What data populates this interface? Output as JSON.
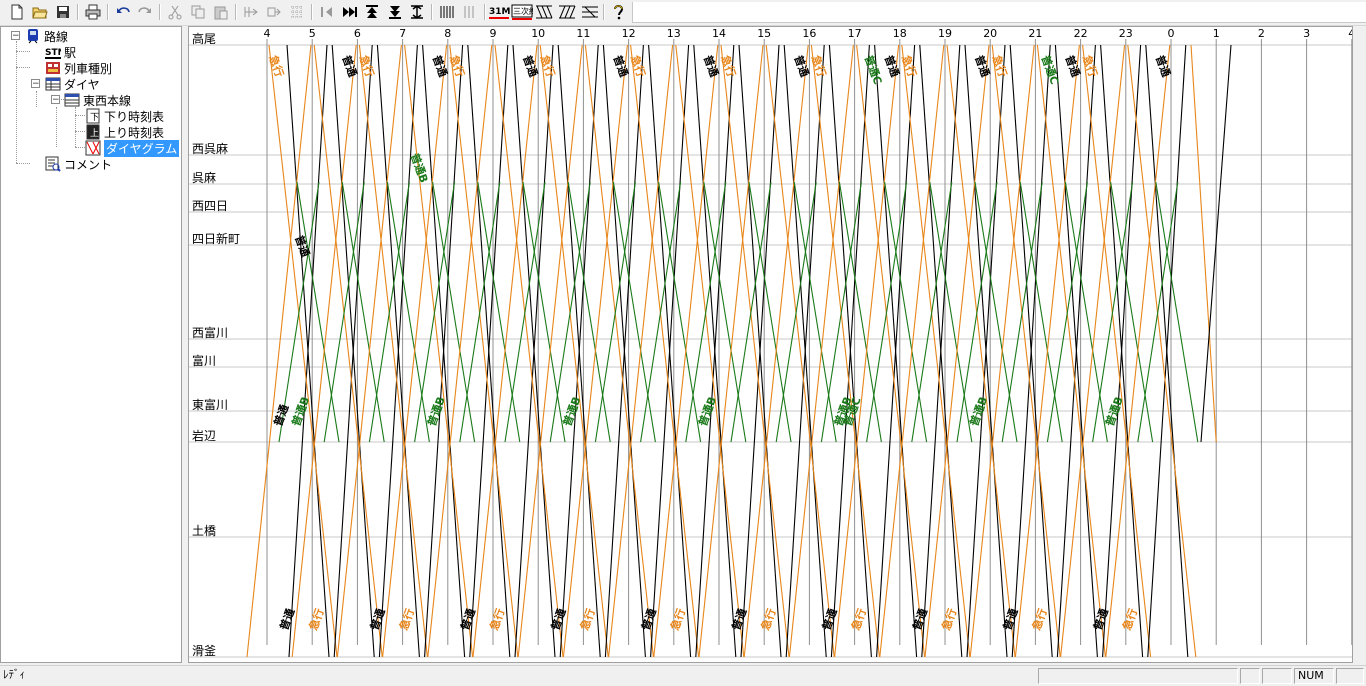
{
  "toolbar": {
    "buttons": [
      {
        "name": "new-file",
        "icon": "new-file-icon"
      },
      {
        "name": "open-folder",
        "icon": "open-folder-icon"
      },
      {
        "name": "save",
        "icon": "save-icon"
      },
      {
        "name": "print",
        "icon": "print-icon"
      },
      {
        "name": "undo",
        "icon": "undo-icon"
      },
      {
        "name": "redo",
        "icon": "redo-icon"
      },
      {
        "name": "cut",
        "icon": "cut-icon"
      },
      {
        "name": "copy",
        "icon": "copy-icon"
      },
      {
        "name": "paste",
        "icon": "paste-icon"
      }
    ],
    "scale_label": "31M",
    "station_label": "三次線"
  },
  "tree": {
    "root": "路線",
    "station": "駅",
    "train_types": "列車種別",
    "dia": "ダイヤ",
    "line": "東西本線",
    "down": "下り時刻表",
    "up": "上り時刻表",
    "diagram": "ダイヤグラム",
    "comment": "コメント"
  },
  "diagram": {
    "colors": {
      "local": "#000000",
      "express": "#e8861a",
      "local_b": "#1a7a1a",
      "grid": "#c8c8c8",
      "hour": "#909090"
    },
    "hours": [
      "4",
      "5",
      "6",
      "7",
      "8",
      "9",
      "10",
      "11",
      "12",
      "13",
      "14",
      "15",
      "16",
      "17",
      "18",
      "19",
      "20",
      "21",
      "22",
      "23",
      "0",
      "1",
      "2",
      "3",
      "4"
    ],
    "stations": [
      {
        "name": "高尾",
        "pos": 0
      },
      {
        "name": "西呉麻",
        "pos": 110
      },
      {
        "name": "呉麻",
        "pos": 139
      },
      {
        "name": "西四日",
        "pos": 167
      },
      {
        "name": "四日新町",
        "pos": 200
      },
      {
        "name": "西富川",
        "pos": 294
      },
      {
        "name": "富川",
        "pos": 322
      },
      {
        "name": "東富川",
        "pos": 366
      },
      {
        "name": "岩辺",
        "pos": 397
      },
      {
        "name": "土橋",
        "pos": 492
      },
      {
        "name": "滑釜",
        "pos": 612
      }
    ],
    "train_labels": {
      "local": "普通",
      "express": "急行",
      "local_b": "普通B",
      "local_c": "普通C"
    }
  },
  "status": {
    "text": "ﾚﾃﾞｨ",
    "num": "NUM"
  }
}
